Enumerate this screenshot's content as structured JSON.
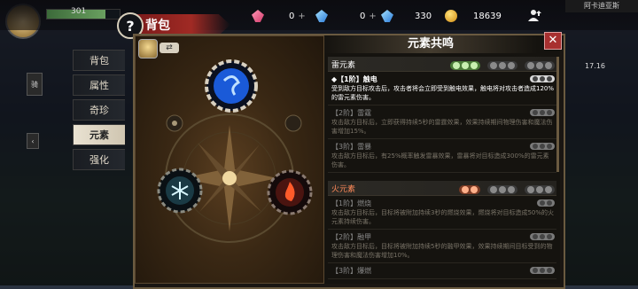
{
  "topbar": {
    "player_hp": "301",
    "help": "?",
    "title": "背包",
    "pink_gem": {
      "value": "0",
      "plus": "+"
    },
    "blue_gem": {
      "value": "0",
      "plus": "+"
    },
    "crystal": "330",
    "gold": "18639",
    "map_label": "阿卡迪亚斯"
  },
  "tabs": [
    {
      "label": "背包"
    },
    {
      "label": "属性"
    },
    {
      "label": "奇珍"
    },
    {
      "label": "元素"
    },
    {
      "label": "强化"
    }
  ],
  "active_tab": "元素",
  "panel": {
    "list_title": "元素共鸣",
    "close": "✕",
    "swap": "⇄"
  },
  "side": {
    "left_btn": "骑",
    "right_number": "17.16"
  },
  "sections": [
    {
      "name": "雷元素",
      "element": "thunder",
      "active_groups": 1,
      "entries": [
        {
          "title": "◆【1阶】触电",
          "desc": "受到敌方目标攻击后，攻击者将会立即受到触电效果，触电将对攻击者造成120%的雷元素伤害。",
          "active": true
        },
        {
          "title": "【2阶】雷霆",
          "desc": "攻击敌方目标后，立即获得持续5秒的雷霆效果，效果持续期间物理伤害和魔法伤害增加15%。",
          "active": false
        },
        {
          "title": "【3阶】雷暴",
          "desc": "攻击敌方目标后，有25%概率触发雷暴效果，雷暴将对目标造成300%的雷元素伤害。",
          "active": false
        }
      ]
    },
    {
      "name": "火元素",
      "element": "fire",
      "active_groups": 1,
      "entries": [
        {
          "title": "【1阶】燃烧",
          "desc": "攻击敌方目标后，目标将被附加持续3秒的燃烧效果，燃烧将对目标造成50%的火元素持续伤害。",
          "active": false
        },
        {
          "title": "【2阶】融甲",
          "desc": "攻击敌方目标后，目标将被附加持续5秒的融甲效果，效果持续期间目标受到的物理伤害和魔法伤害增加10%。",
          "active": false
        },
        {
          "title": "【3阶】爆燃",
          "desc": "",
          "active": false
        }
      ]
    }
  ],
  "colors": {
    "thunder": "#2a6ad8",
    "fire": "#c83a1a",
    "ice": "#8ad8e8",
    "active_pill": "#4a7a38",
    "panel_border": "#6a5a40"
  }
}
